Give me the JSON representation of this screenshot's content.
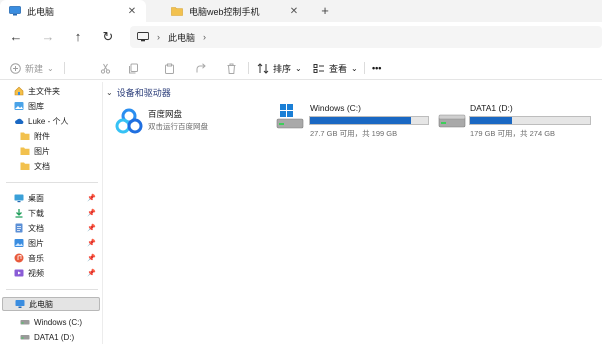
{
  "tabs": [
    {
      "label": "此电脑",
      "close": "✕",
      "icon": "computer-icon"
    },
    {
      "label": "电脑web控制手机",
      "close": "✕",
      "icon": "folder-icon"
    }
  ],
  "new_tab": "+",
  "nav": {
    "back": "←",
    "forward": "→",
    "up": "↑",
    "refresh": "↻"
  },
  "address": {
    "crumb": "此电脑",
    "chevron": "›",
    "end_chevron": "›"
  },
  "toolbar": {
    "new_label": "新建",
    "sort_label": "排序",
    "view_label": "查看",
    "more_label": "•••",
    "dropdown": "⌄"
  },
  "sidebar": {
    "quick": [
      {
        "label": "主文件夹",
        "icon": "home-icon"
      },
      {
        "label": "图库",
        "icon": "gallery-icon"
      },
      {
        "label": "Luke - 个人",
        "icon": "onedrive-icon"
      },
      {
        "label": "附件",
        "icon": "folder-icon"
      },
      {
        "label": "图片",
        "icon": "folder-icon"
      },
      {
        "label": "文档",
        "icon": "folder-icon"
      }
    ],
    "pinned": [
      {
        "label": "桌面",
        "icon": "desktop-icon"
      },
      {
        "label": "下载",
        "icon": "download-icon"
      },
      {
        "label": "文档",
        "icon": "documents-icon"
      },
      {
        "label": "图片",
        "icon": "pictures-icon"
      },
      {
        "label": "音乐",
        "icon": "music-icon"
      },
      {
        "label": "视频",
        "icon": "video-icon"
      }
    ],
    "pin_glyph": "📌",
    "this_pc": "此电脑",
    "drives": [
      {
        "label": "Windows (C:)",
        "icon": "drive-icon"
      },
      {
        "label": "DATA1 (D:)",
        "icon": "drive-icon"
      }
    ]
  },
  "content": {
    "group_title": "设备和驱动器",
    "group_chevron": "⌄",
    "baidu": {
      "name": "百度网盘",
      "sub": "双击运行百度网盘"
    },
    "drives": [
      {
        "name": "Windows (C:)",
        "usage": "27.7 GB 可用，共 199 GB",
        "used_fraction": 0.86
      },
      {
        "name": "DATA1 (D:)",
        "usage": "179 GB 可用，共 274 GB",
        "used_fraction": 0.35
      }
    ]
  },
  "colors": {
    "accent": "#1a68c3",
    "folder": "#f2c14e",
    "sidebar_selected": "#e4e4e4"
  }
}
